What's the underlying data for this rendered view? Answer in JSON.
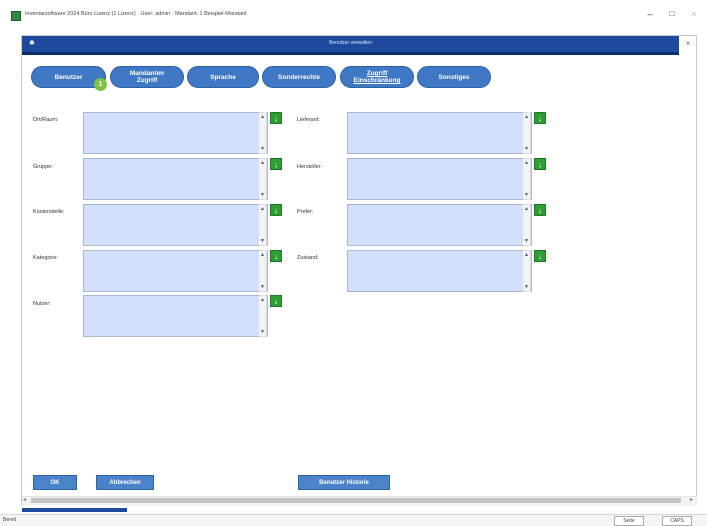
{
  "window": {
    "title": "Inventarsoftware 2024 Büro Lizenz (1 Lizenz) · User: admin · Mandant: 1 Beispiel-Mandant",
    "controls": {
      "minimize": "–",
      "maximize": "□",
      "close": "×"
    }
  },
  "dialog": {
    "title": "Benutzer verwalten",
    "header_icon": "✱",
    "close": "×"
  },
  "tabs": {
    "benutzer": "Benutzer",
    "mandanten_line1": "Mandanten",
    "mandanten_line2": "Zugriff",
    "sprache": "Sprache",
    "sonderrechte": "Sonderrechte",
    "zugriff_line1": "Zugriff",
    "zugriff_line2": "Einschränkung",
    "sonstiges": "Sonstiges",
    "badge": "1"
  },
  "fields": {
    "standort": "Ort/Raum:",
    "gruppe": "Gruppe:",
    "kostenstelle": "Kostenstelle:",
    "kategorie": "Kategorie:",
    "nutzer": "Nutzer:",
    "lieferant": "Lieferant:",
    "hersteller": "Hersteller:",
    "prefer": "Prefer:",
    "zustand": "Zustand:"
  },
  "icons": {
    "add": "↓",
    "scroll_up": "▲",
    "scroll_down": "▼",
    "scroll_left": "◂",
    "scroll_right": "▸"
  },
  "buttons": {
    "ok": "OK",
    "abbrechen": "Abbrechen",
    "historie": "Benutzer Historie"
  },
  "statusbar": {
    "text": "Bereit",
    "seite": "Seite",
    "caps": "CAPS"
  },
  "colors": {
    "header": "#1d4a9c",
    "tab": "#3f78c4",
    "listbox": "#d2e0fb",
    "add_button": "#2e9e34",
    "badge": "#7cc243"
  }
}
